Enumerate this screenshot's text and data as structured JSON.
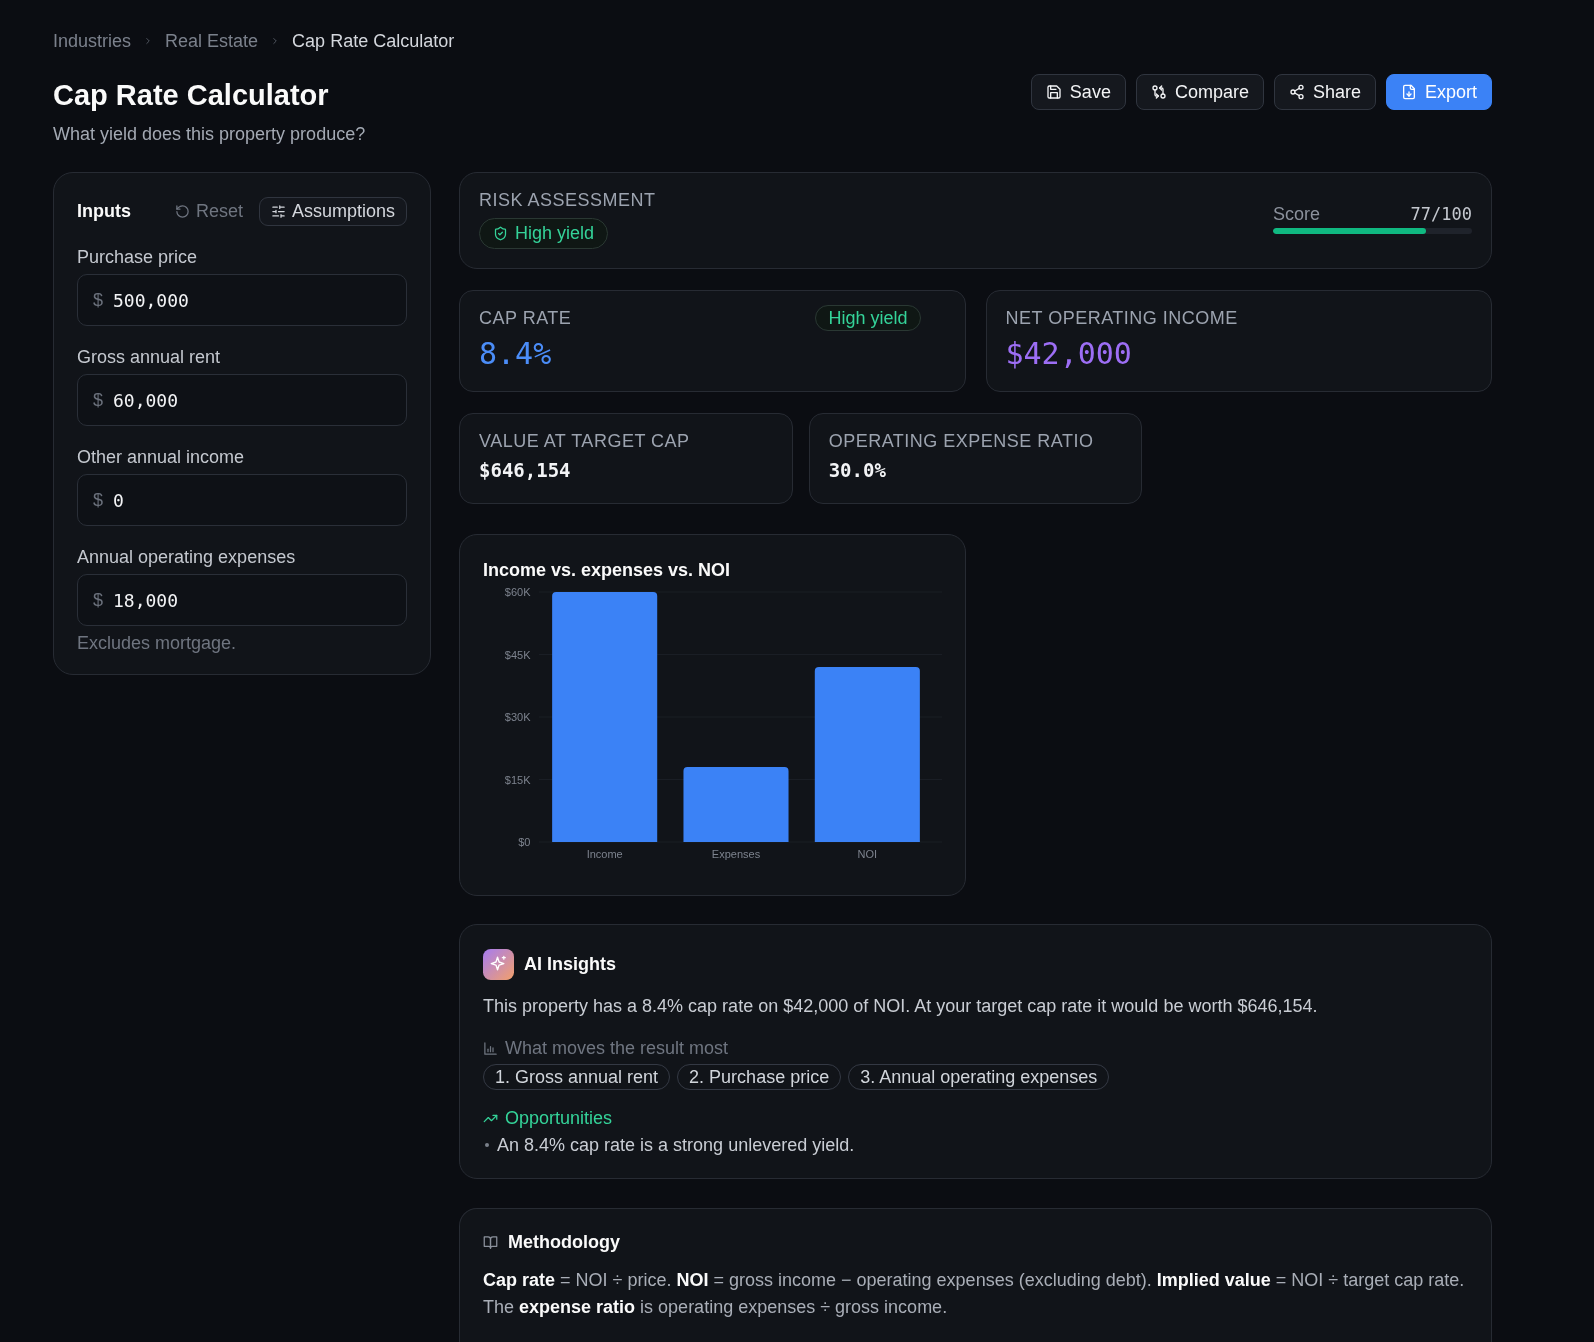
{
  "breadcrumb": [
    {
      "label": "Industries",
      "current": false
    },
    {
      "label": "Real Estate",
      "current": false
    },
    {
      "label": "Cap Rate Calculator",
      "current": true
    }
  ],
  "header": {
    "title": "Cap Rate Calculator",
    "subtitle": "What yield does this property produce?"
  },
  "actions": [
    {
      "label": "Save",
      "kind": "secondary"
    },
    {
      "label": "Compare",
      "kind": "secondary"
    },
    {
      "label": "Share",
      "kind": "secondary"
    },
    {
      "label": "Export",
      "kind": "primary"
    }
  ],
  "inputs": {
    "title": "Inputs",
    "reset": "Reset",
    "assumptions": "Assumptions",
    "fields": [
      {
        "label": "Purchase price",
        "prefix": "$",
        "value": "500,000"
      },
      {
        "label": "Gross annual rent",
        "prefix": "$",
        "value": "60,000"
      },
      {
        "label": "Other annual income",
        "prefix": "$",
        "value": "0"
      },
      {
        "label": "Annual operating expenses",
        "prefix": "$",
        "value": "18,000"
      }
    ],
    "note": "Excludes mortgage."
  },
  "risk": {
    "heading": "RISK ASSESSMENT",
    "badge": "High yield",
    "score_label": "Score",
    "score": "77/100",
    "level": 0.77
  },
  "primary_metrics": [
    {
      "label": "CAP RATE",
      "value": "8.4%",
      "badge": "High yield",
      "color": "#4b8df8"
    },
    {
      "label": "NET OPERATING INCOME",
      "value": "$42,000",
      "color": "#9d6ef5"
    }
  ],
  "secondary_metrics": [
    {
      "label": "VALUE AT TARGET CAP",
      "value": "$646,154"
    },
    {
      "label": "OPERATING EXPENSE RATIO",
      "value": "30.0%"
    }
  ],
  "chart": {
    "chart_data": {
      "type": "bar",
      "title": "Income vs. expenses vs. NOI",
      "categories": [
        "Income",
        "Expenses",
        "NOI"
      ],
      "values": [
        60000,
        18000,
        42000
      ],
      "ylim": [
        0,
        60000
      ],
      "yticks": [
        {
          "value": 0,
          "label": "$0"
        },
        {
          "value": 15000,
          "label": "$15K"
        },
        {
          "value": 30000,
          "label": "$30K"
        },
        {
          "value": 45000,
          "label": "$45K"
        },
        {
          "value": 60000,
          "label": "$60K"
        }
      ]
    }
  },
  "insights": {
    "title": "AI Insights",
    "summary": "This property has a 8.4% cap rate on $42,000 of NOI. At your target cap rate it would be worth $646,154.",
    "drivers_heading": "What moves the result most",
    "drivers": [
      "1. Gross annual rent",
      "2. Purchase price",
      "3. Annual operating expenses"
    ],
    "opportunities_heading": "Opportunities",
    "opportunities": [
      "An 8.4% cap rate is a strong unlevered yield."
    ]
  },
  "methodology": {
    "title": "Methodology",
    "text": "**Cap rate** = NOI ÷ price. **NOI** = gross income − operating expenses (excluding debt). **Implied value** = NOI ÷ target cap rate. The **expense ratio** is operating expenses ÷ gross income."
  }
}
